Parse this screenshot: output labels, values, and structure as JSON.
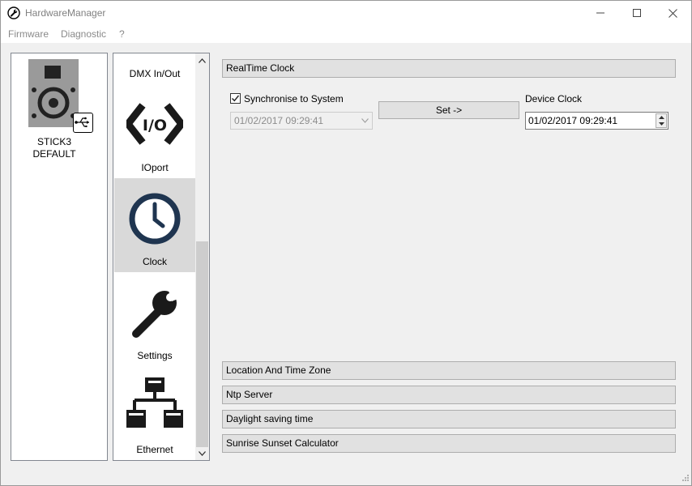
{
  "window": {
    "title": "HardwareManager",
    "icons": {
      "app": "wrench-circle-icon",
      "minimize": "minimize-icon",
      "maximize": "maximize-icon",
      "close": "close-icon"
    }
  },
  "menu": {
    "items": [
      "Firmware",
      "Diagnostic",
      "?"
    ]
  },
  "devices": [
    {
      "label_line1": "STICK3",
      "label_line2": "DEFAULT",
      "icon": "speaker-device-icon",
      "badge_icon": "usb-icon"
    }
  ],
  "modules": [
    {
      "label": "DMX In/Out",
      "icon": "dmx-icon",
      "selected": false
    },
    {
      "label": "IOport",
      "icon": "io-code-icon",
      "selected": false
    },
    {
      "label": "Clock",
      "icon": "clock-icon",
      "selected": true
    },
    {
      "label": "Settings",
      "icon": "wrench-icon",
      "selected": false
    },
    {
      "label": "Ethernet",
      "icon": "network-icon",
      "selected": false
    }
  ],
  "realtime_clock": {
    "header": "RealTime Clock",
    "sync_label": "Synchronise to System",
    "sync_checked": true,
    "system_time": "01/02/2017 09:29:41",
    "set_button": "Set ->",
    "device_clock_label": "Device Clock",
    "device_clock_value": "01/02/2017 09:29:41"
  },
  "sections": [
    "Location And Time Zone",
    "Ntp Server",
    "Daylight saving time",
    "Sunrise Sunset Calculator"
  ]
}
